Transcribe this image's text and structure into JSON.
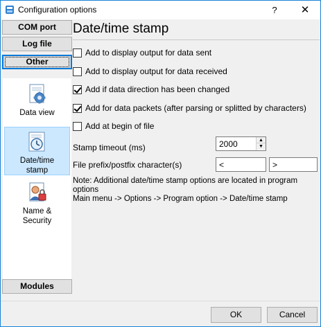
{
  "window": {
    "title": "Configuration options",
    "help_glyph": "?",
    "close_glyph": "✕"
  },
  "sidebar": {
    "buttons": [
      {
        "label": "COM port"
      },
      {
        "label": "Log file"
      },
      {
        "label": "Other"
      }
    ],
    "items": [
      {
        "label": "Data view",
        "icon": "data-view-gear-icon"
      },
      {
        "label": "Date/time stamp",
        "icon": "clock-icon",
        "line1": "Date/time",
        "line2": "stamp"
      },
      {
        "label": "Name & Security",
        "icon": "lock-user-icon",
        "line1": "Name &",
        "line2": "Security"
      }
    ],
    "modules_label": "Modules"
  },
  "main": {
    "title": "Date/time stamp",
    "options": [
      {
        "label": "Add to display output for data sent",
        "checked": false
      },
      {
        "label": "Add to display output for data received",
        "checked": false
      },
      {
        "label": "Add if data direction has been changed",
        "checked": true
      },
      {
        "label": "Add for data packets (after parsing or splitted by characters)",
        "checked": true
      },
      {
        "label": "Add at begin of file",
        "checked": false
      }
    ],
    "stamp_timeout": {
      "label": "Stamp timeout (ms)",
      "value": "2000"
    },
    "prefix_postfix": {
      "label": "File prefix/postfix character(s)",
      "prefix": "<",
      "postfix": ">"
    },
    "note_line1": "Note: Additional date/time stamp options are located in program options",
    "note_line2": "Main menu -> Options -> Program option -> Date/time stamp"
  },
  "footer": {
    "ok_label": "OK",
    "cancel_label": "Cancel"
  }
}
